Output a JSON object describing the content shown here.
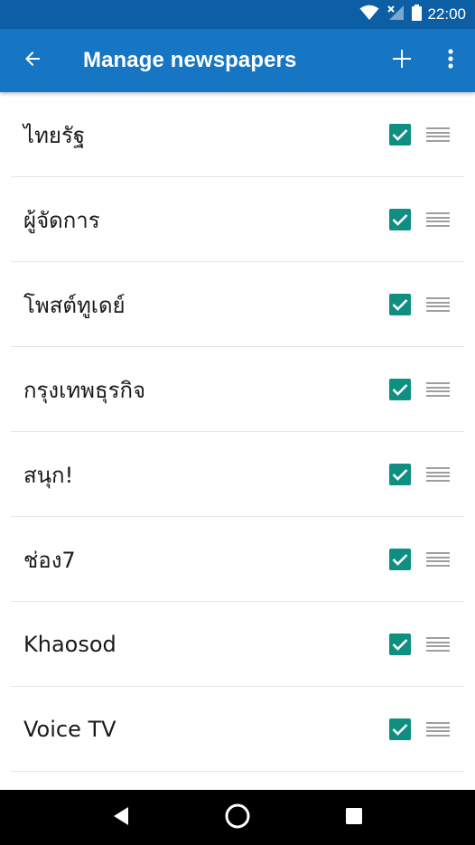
{
  "status_bar": {
    "time": "22:00",
    "icons": [
      "wifi-icon",
      "signal-no-service-icon",
      "battery-icon"
    ]
  },
  "app_bar": {
    "title": "Manage newspapers",
    "back_icon": "arrow-left-icon",
    "add_icon": "plus-icon",
    "menu_icon": "more-vert-icon"
  },
  "colors": {
    "status_bar": "#0d5fa5",
    "app_bar": "#1776c3",
    "checkbox": "#0e8f82",
    "handle": "#9e9e9e"
  },
  "newspapers": [
    {
      "name": "ไทยรัฐ",
      "checked": true
    },
    {
      "name": "ผู้จัดการ",
      "checked": true
    },
    {
      "name": "โพสต์ทูเดย์",
      "checked": true
    },
    {
      "name": "กรุงเทพธุรกิจ",
      "checked": true
    },
    {
      "name": "สนุก!",
      "checked": true
    },
    {
      "name": "ช่อง7",
      "checked": true
    },
    {
      "name": "Khaosod",
      "checked": true
    },
    {
      "name": "Voice TV",
      "checked": true
    }
  ],
  "nav_bar": {
    "icons": [
      "back-triangle-icon",
      "home-circle-icon",
      "recents-square-icon"
    ]
  }
}
